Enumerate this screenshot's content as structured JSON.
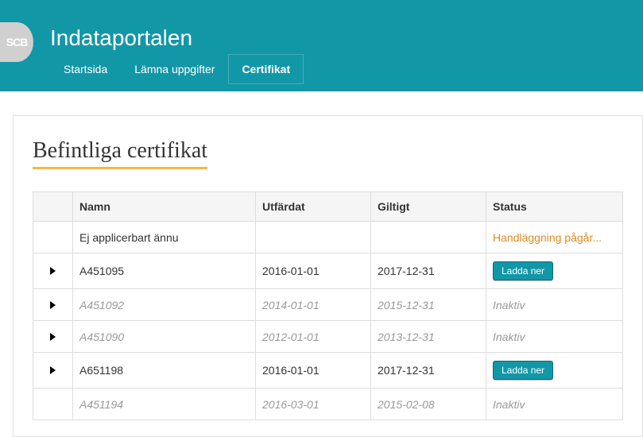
{
  "header": {
    "logo_text": "SCB",
    "app_title": "Indataportalen"
  },
  "nav": {
    "items": [
      {
        "label": "Startsida",
        "active": false
      },
      {
        "label": "Lämna uppgifter",
        "active": false
      },
      {
        "label": "Certifikat",
        "active": true
      }
    ]
  },
  "panel": {
    "title": "Befintliga certifikat"
  },
  "table": {
    "columns": {
      "name": "Namn",
      "issued": "Utfärdat",
      "valid": "Giltigt",
      "status": "Status"
    },
    "status_labels": {
      "processing": "Handläggning pågår...",
      "download": "Ladda ner",
      "inactive": "Inaktiv"
    },
    "rows": [
      {
        "expand": false,
        "name": "Ej applicerbart ännu",
        "issued": "",
        "valid": "",
        "status_type": "processing",
        "inactive": false
      },
      {
        "expand": true,
        "name": "A451095",
        "issued": "2016-01-01",
        "valid": "2017-12-31",
        "status_type": "download",
        "inactive": false
      },
      {
        "expand": true,
        "name": "A451092",
        "issued": "2014-01-01",
        "valid": "2015-12-31",
        "status_type": "inactive",
        "inactive": true
      },
      {
        "expand": true,
        "name": "A451090",
        "issued": "2012-01-01",
        "valid": "2013-12-31",
        "status_type": "inactive",
        "inactive": true
      },
      {
        "expand": true,
        "name": "A651198",
        "issued": "2016-01-01",
        "valid": "2017-12-31",
        "status_type": "download",
        "inactive": false
      },
      {
        "expand": false,
        "name": "A451194",
        "issued": "2016-03-01",
        "valid": "2015-02-08",
        "status_type": "inactive",
        "inactive": true
      }
    ]
  }
}
